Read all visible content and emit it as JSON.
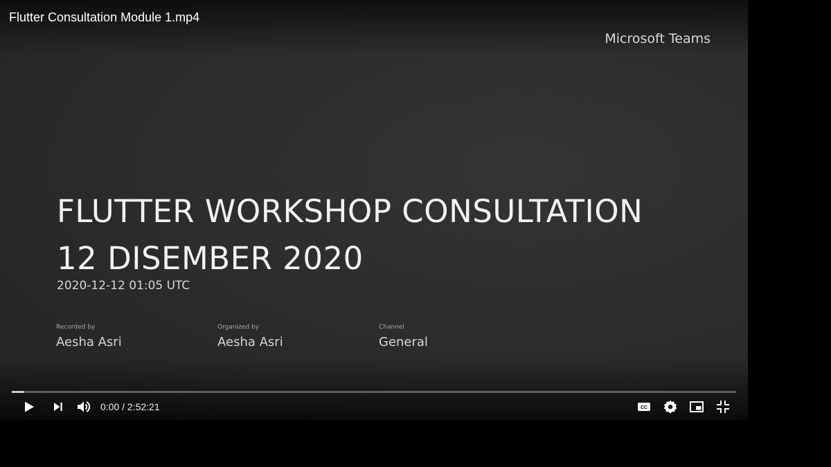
{
  "video": {
    "title": "Flutter Consultation Module 1.mp4"
  },
  "slide": {
    "brand": "Microsoft Teams",
    "title_line1": "FLUTTER WORKSHOP CONSULTATION",
    "title_line2": "12 DISEMBER 2020",
    "timestamp": "2020-12-12 01:05 UTC",
    "meta": [
      {
        "label": "Recorded by",
        "value": "Aesha  Asri"
      },
      {
        "label": "Organized by",
        "value": "Aesha  Asri"
      },
      {
        "label": "Channel",
        "value": "General"
      }
    ]
  },
  "player": {
    "current_time": "0:00",
    "separator": "/",
    "duration": "2:52:21",
    "progress_fraction": 0.017,
    "icons": [
      "play-icon",
      "next-icon",
      "volume-icon",
      "captions-icon",
      "settings-icon",
      "miniplayer-icon",
      "exit-fullscreen-icon"
    ]
  }
}
